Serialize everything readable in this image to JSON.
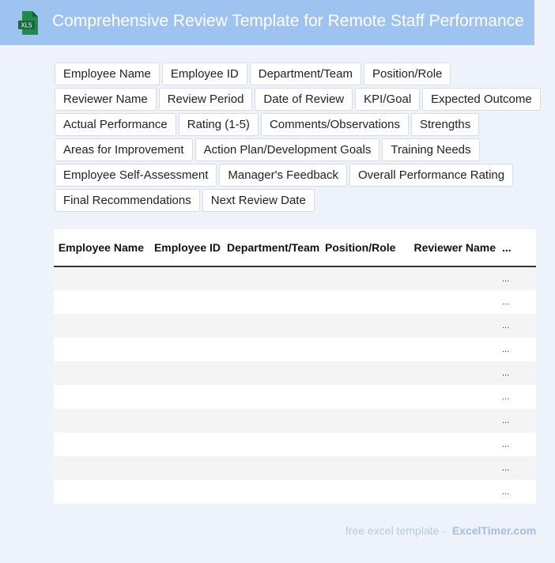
{
  "header": {
    "icon_label": "XLS",
    "title": "Comprehensive Review Template for Remote Staff Performance"
  },
  "tags": [
    "Employee Name",
    "Employee ID",
    "Department/Team",
    "Position/Role",
    "Reviewer Name",
    "Review Period",
    "Date of Review",
    "KPI/Goal",
    "Expected Outcome",
    "Actual Performance",
    "Rating (1-5)",
    "Comments/Observations",
    "Strengths",
    "Areas for Improvement",
    "Action Plan/Development Goals",
    "Training Needs",
    "Employee Self-Assessment",
    "Manager's Feedback",
    "Overall Performance Rating",
    "Final Recommendations",
    "Next Review Date"
  ],
  "table": {
    "headers": [
      "Employee Name",
      "Employee ID",
      "Department/Team",
      "Position/Role",
      "Reviewer Name",
      "..."
    ],
    "row_marker": "...",
    "row_count": 10
  },
  "footer": {
    "text": "free excel template -",
    "brand": "ExcelTimer.com"
  },
  "colors": {
    "header_bg": "#9ec3f1",
    "page_bg": "#eef3fb",
    "xls_icon": "#1f7a44"
  }
}
